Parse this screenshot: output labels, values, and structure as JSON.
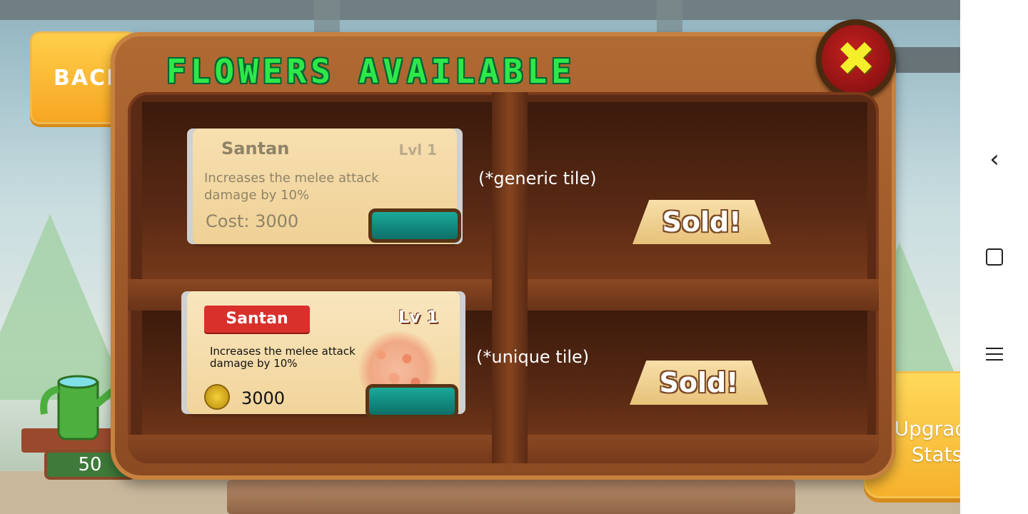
{
  "back_button": {
    "label": "BACK"
  },
  "panel": {
    "title": "FLOWERS AVAILABLE",
    "close_symbol": "✖"
  },
  "cards": {
    "generic": {
      "name": "Santan",
      "level": "Lvl 1",
      "description": "Increases the melee attack damage by 10%",
      "cost": "Cost: 3000",
      "note": "(*generic tile)"
    },
    "unique": {
      "name": "Santan",
      "level": "Lv 1",
      "description": "Increases the melee attack damage by 10%",
      "cost": "3000",
      "note": "(*unique tile)"
    }
  },
  "sold": {
    "label_1": "Sold!",
    "label_2": "Sold!"
  },
  "upgrade_button": {
    "line1": "Upgrade",
    "line2": "Stats"
  },
  "water_counter": {
    "value": "50"
  },
  "colors": {
    "title_green": "#2ee84a",
    "panel_wood": "#b16a33",
    "close_red": "#c42020",
    "button_teal": "#1aa99a",
    "upgrade_yellow": "#ffd95b"
  },
  "icons": [
    "close-icon",
    "coin-icon",
    "watering-can-icon",
    "nav-back-icon",
    "nav-home-icon",
    "nav-menu-icon"
  ]
}
